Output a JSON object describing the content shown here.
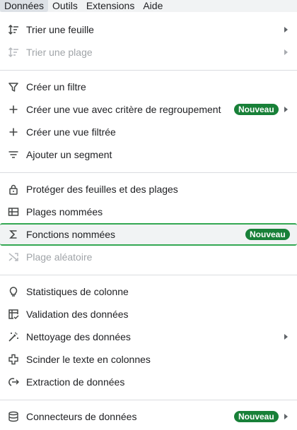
{
  "menubar": {
    "items": [
      "Données",
      "Outils",
      "Extensions",
      "Aide"
    ]
  },
  "menu": {
    "items": [
      {
        "label": "Trier une feuille",
        "icon": "sort-icon"
      },
      {
        "label": "Trier une plage",
        "icon": "sort-range-icon"
      },
      {
        "label": "Créer un filtre",
        "icon": "filter-icon"
      },
      {
        "label": "Créer une vue avec critère de regroupement",
        "icon": "plus-icon",
        "badge": "Nouveau"
      },
      {
        "label": "Créer une vue filtrée",
        "icon": "plus-icon"
      },
      {
        "label": "Ajouter un segment",
        "icon": "slicer-icon"
      },
      {
        "label": "Protéger des feuilles et des plages",
        "icon": "lock-icon"
      },
      {
        "label": "Plages nommées",
        "icon": "named-ranges-icon"
      },
      {
        "label": "Fonctions nommées",
        "icon": "sigma-icon",
        "badge": "Nouveau"
      },
      {
        "label": "Plage aléatoire",
        "icon": "shuffle-icon"
      },
      {
        "label": "Statistiques de colonne",
        "icon": "lightbulb-icon"
      },
      {
        "label": "Validation des données",
        "icon": "data-validation-icon"
      },
      {
        "label": "Nettoyage des données",
        "icon": "magic-wand-icon"
      },
      {
        "label": "Scinder le texte en colonnes",
        "icon": "split-icon"
      },
      {
        "label": "Extraction de données",
        "icon": "extract-icon"
      },
      {
        "label": "Connecteurs de données",
        "icon": "database-icon",
        "badge": "Nouveau"
      }
    ]
  },
  "colors": {
    "badge": "#188038",
    "highlight_border": "#34a853",
    "disabled_text": "#a0a4a8"
  }
}
